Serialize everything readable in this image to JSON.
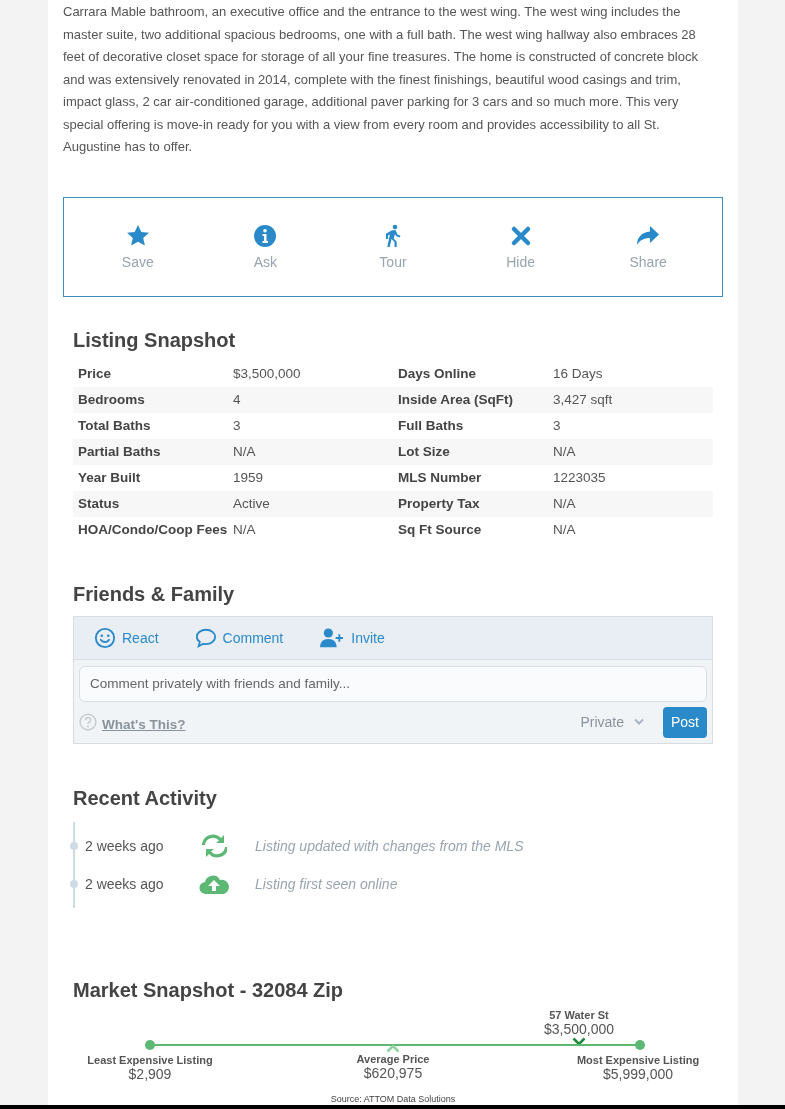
{
  "description": "Carrara Mable bathroom, an executive office and the entrance to the west wing. The west wing includes the master suite, two additional spacious bedrooms, one with a full bath. The west wing hallway also embraces 28 feet of decorative closet space for storage of all your fine treasures. The home is constructed of concrete block and was extensively renovated in 2014, complete with the finest finishings, beautiful wood casings and trim, impact glass, 2 car air-conditioned garage, additional paver parking for 3 cars and so much more. This very special offering is move-in ready for you with a view from every room and provides accessibility to all St. Augustine has to offer.",
  "actions": [
    {
      "kind": "star",
      "label": "Save"
    },
    {
      "kind": "info",
      "label": "Ask"
    },
    {
      "kind": "walk",
      "label": "Tour"
    },
    {
      "kind": "hide",
      "label": "Hide"
    },
    {
      "kind": "share",
      "label": "Share"
    }
  ],
  "listing_snapshot": {
    "title": "Listing Snapshot",
    "rows": [
      {
        "label": "Price",
        "value": "$3,500,000",
        "label_2": "Days Online",
        "value_2": "16 Days"
      },
      {
        "label": "Bedrooms",
        "value": "4",
        "label_2": "Inside Area (SqFt)",
        "value_2": "3,427 sqft"
      },
      {
        "label": "Total Baths",
        "value": "3",
        "label_2": "Full Baths",
        "value_2": "3"
      },
      {
        "label": "Partial Baths",
        "value": "N/A",
        "label_2": "Lot Size",
        "value_2": "N/A"
      },
      {
        "label": "Year Built",
        "value": "1959",
        "label_2": "MLS Number",
        "value_2": "1223035"
      },
      {
        "label": "Status",
        "value": "Active",
        "label_2": "Property Tax",
        "value_2": "N/A"
      },
      {
        "label": "HOA/Condo/Coop Fees",
        "value": "N/A",
        "label_2": "Sq Ft Source",
        "value_2": "N/A"
      }
    ]
  },
  "friends_family": {
    "title": "Friends & Family",
    "tabs": [
      {
        "kind": "react",
        "label": "React"
      },
      {
        "kind": "comment",
        "label": "Comment"
      },
      {
        "kind": "invite",
        "label": "Invite"
      }
    ],
    "comment_field": {
      "placeholder": "Comment privately with friends and family..."
    },
    "help_link": "What's This?",
    "privacy_select": {
      "value": "Private"
    },
    "post_button": "Post"
  },
  "recent_activity": {
    "title": "Recent Activity",
    "items": [
      {
        "time": "2 weeks ago",
        "kind": "updated",
        "text": "Listing updated with changes from the MLS"
      },
      {
        "time": "2 weeks ago",
        "kind": "online",
        "text": "Listing first seen online"
      }
    ]
  },
  "market_snapshot": {
    "title": "Market Snapshot - 32084 Zip",
    "subject": {
      "name": "57 Water St",
      "price": "$3,500,000"
    },
    "least": {
      "label": "Least Expensive Listing",
      "price": "$2,909"
    },
    "average": {
      "label": "Average Price",
      "price": "$620,975"
    },
    "most": {
      "label": "Most Expensive Listing",
      "price": "$5,999,000"
    },
    "source": "Source: ATTOM Data Solutions"
  }
}
